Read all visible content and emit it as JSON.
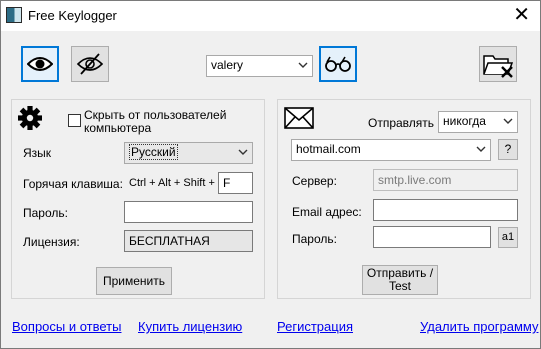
{
  "window": {
    "title": "Free Keylogger"
  },
  "toolbar": {
    "user_selected": "valery"
  },
  "left": {
    "hide_label": "Скрыть от пользователей компьютера",
    "language_label": "Язык",
    "language_value": "Русский",
    "hotkey_label": "Горячая клавиша:",
    "hotkey_combo": "Ctrl + Alt + Shift +",
    "hotkey_key": "F",
    "password_label": "Пароль:",
    "password_value": "",
    "license_label": "Лицензия:",
    "license_value": "БЕСПЛАТНАЯ",
    "apply_label": "Применить"
  },
  "right": {
    "send_label": "Отправлять",
    "send_value": "никогда",
    "provider_value": "hotmail.com",
    "help_label": "?",
    "server_label": "Сервер:",
    "server_value": "smtp.live.com",
    "email_label": "Email адрес:",
    "email_value": "",
    "password_label": "Пароль:",
    "password_value": "",
    "password_toggle": "a1",
    "send_test_label": "Отправить / Test"
  },
  "footer": {
    "faq": "Вопросы и ответы",
    "buy": "Купить лицензию",
    "register": "Регистрация",
    "uninstall": "Удалить программу"
  }
}
